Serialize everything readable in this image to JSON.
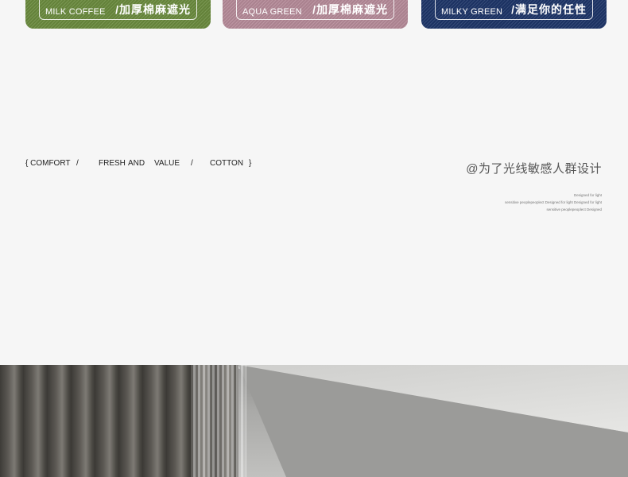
{
  "cards": [
    {
      "en": "MILK COFFEE",
      "cn": "/加厚棉麻遮光",
      "color": "#6a8a3e"
    },
    {
      "en": "AQUA GREEN",
      "cn": "/加厚棉麻遮光",
      "color": "#b58a98"
    },
    {
      "en": "MILKY GREEN",
      "cn": "/满足你的任性",
      "color": "#1e3568"
    }
  ],
  "tagline": {
    "open": "{ COMFORT",
    "sep1": "/",
    "fresh": "FRESH",
    "and": "AND",
    "value": "VALUE",
    "sep2": "/",
    "cotton": "COTTON",
    "close": "}"
  },
  "subtitle_cn": "@为了光线敏感人群设计",
  "small_lines": [
    "Designed for light",
    "sensitive peoplepeoplect Designed for light Designed for light",
    "sensitive peoplepeoplect Designed"
  ]
}
